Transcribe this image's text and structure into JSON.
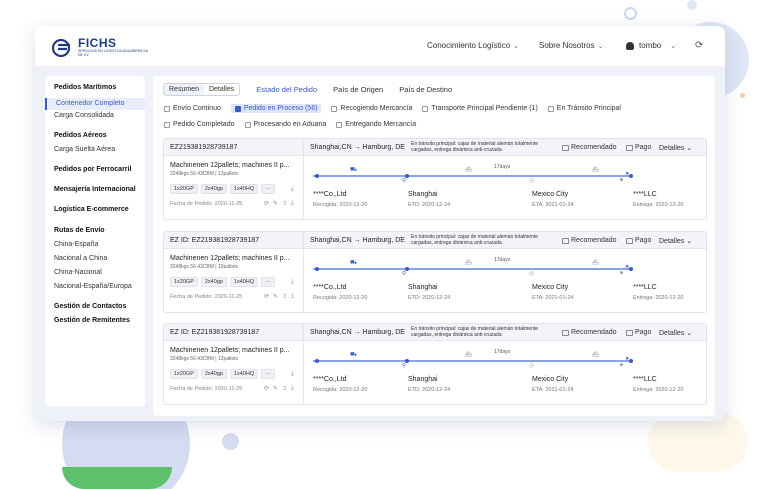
{
  "brand": {
    "name": "FICHS",
    "subtitle": "SERVICIOS EN LOGISTICA ADUANERA SA DE CV"
  },
  "nav": {
    "item1": "Conocimiento Logístico",
    "item2": "Sobre Nosotros",
    "user": "tombo"
  },
  "sidebar": {
    "items": [
      {
        "label": "Pedidos Marítimos",
        "style": "bold"
      },
      {
        "label": "Contenedor Completo",
        "style": "active"
      },
      {
        "label": "Carga Consolidada",
        "style": "normal"
      },
      {
        "label": "Pedidos Aéreos",
        "style": "bold"
      },
      {
        "label": "Carga Suelta Aérea",
        "style": "normal"
      },
      {
        "label": "Pedidos por Ferrocarril",
        "style": "bold"
      },
      {
        "label": "Mensajería Internacional",
        "style": "bold"
      },
      {
        "label": "Logística E-commerce",
        "style": "bold"
      },
      {
        "label": "Rutas de Envío",
        "style": "bold"
      },
      {
        "label": "China-España",
        "style": "normal"
      },
      {
        "label": "Nacional a China",
        "style": "normal"
      },
      {
        "label": "China-Nacional",
        "style": "normal"
      },
      {
        "label": "Nacional-España/Europa",
        "style": "normal"
      },
      {
        "label": "Gestión de Contactos",
        "style": "bold"
      },
      {
        "label": "Gestión de Remitentes",
        "style": "bold"
      }
    ]
  },
  "tabs": {
    "seg_summary": "Resumen",
    "seg_details": "Detalles",
    "order_status": "Estado del Pedido",
    "origin": "País de Origen",
    "destination": "País de Destino"
  },
  "filters": {
    "row1": [
      "Envío Continuo",
      "Pedido en Proceso (56)",
      "Recogiendo Mercancía",
      "Transporte Principal Pendiente (1)",
      "En Tránsito Principal"
    ],
    "row2": [
      "Pedido Completado",
      "Procesando en Aduana",
      "Entregando Mercancía"
    ],
    "checked": "Pedido en Proceso (56)"
  },
  "cards": [
    {
      "id": "EZ219381928739187",
      "route": "Shanghai,CN → Hamburg, DE",
      "status": "En tránsito principal: cajas de material alemán totalmente cargadas, entrega dinámica anti-cruzada",
      "recommended": "Recomendado",
      "payment": "Pago",
      "details": "Detalles",
      "product": "Machinenen 12pallets; machines II p...",
      "product_sub": "3248kgs  56.43CBM | 12pallets",
      "chips": [
        "1x20GP",
        "2x40gp",
        "1x40HQ",
        "···"
      ],
      "order_date": "Fecha de Pedido: 2020-11-25",
      "days": "17days",
      "stops": [
        {
          "name": "****Co.,Ltd",
          "sub": "Recogida: 2020-12-20"
        },
        {
          "name": "Shanghai",
          "sub": "ETD: 2020-12-24"
        },
        {
          "name": "Mexico City",
          "sub": "ETA: 2021-01-24"
        },
        {
          "name": "****LLC",
          "sub": "Entrega: 2020-12-20"
        }
      ]
    },
    {
      "id": "EZ ID:  EZ219381928739187",
      "route": "Shanghai,CN → Hamburg, DE",
      "status": "En tránsito principal: cajas de material alemán totalmente cargadas, entrega dinámica anti-cruzada",
      "recommended": "Recomendado",
      "payment": "Pago",
      "details": "Detalles",
      "product": "Machinenen 12pallets; machines II p...",
      "product_sub": "3248kgs  56.43CBM | 12pallets",
      "chips": [
        "1x20GP",
        "2x40gp",
        "1x40HQ",
        "···"
      ],
      "order_date": "Fecha de Pedido: 2020-11-25",
      "days": "17days",
      "stops": [
        {
          "name": "****Co.,Ltd",
          "sub": "Recogida: 2020-12-20"
        },
        {
          "name": "Shanghai",
          "sub": "ETD: 2020-12-24"
        },
        {
          "name": "Mexico City",
          "sub": "ETA: 2021-01-24"
        },
        {
          "name": "****LLC",
          "sub": "Entrega: 2020-12-20"
        }
      ]
    },
    {
      "id": "EZ ID:  EZ219381928739187",
      "route": "Shanghai,CN → Hamburg, DE",
      "status": "En tránsito principal: cajas de material alemán totalmente cargadas, entrega dinámica anti-cruzada",
      "recommended": "Recomendado",
      "payment": "Pago",
      "details": "Detalles",
      "product": "Machinenen 12pallets; machines II p...",
      "product_sub": "3248kgs  56.43CBM | 12pallets",
      "chips": [
        "1x20GP",
        "2x40gp",
        "1x40HQ",
        "···"
      ],
      "order_date": "Fecha de Pedido: 2020-11-25",
      "days": "17days",
      "stops": [
        {
          "name": "****Co.,Ltd",
          "sub": "Recogida: 2020-12-20"
        },
        {
          "name": "Shanghai",
          "sub": "ETD: 2020-12-24"
        },
        {
          "name": "Mexico City",
          "sub": "ETA: 2021-01-24"
        },
        {
          "name": "****LLC",
          "sub": "Entrega: 2020-12-20"
        }
      ]
    }
  ],
  "colors": {
    "accent": "#3a5bbf",
    "brand": "#1f3c7d"
  }
}
